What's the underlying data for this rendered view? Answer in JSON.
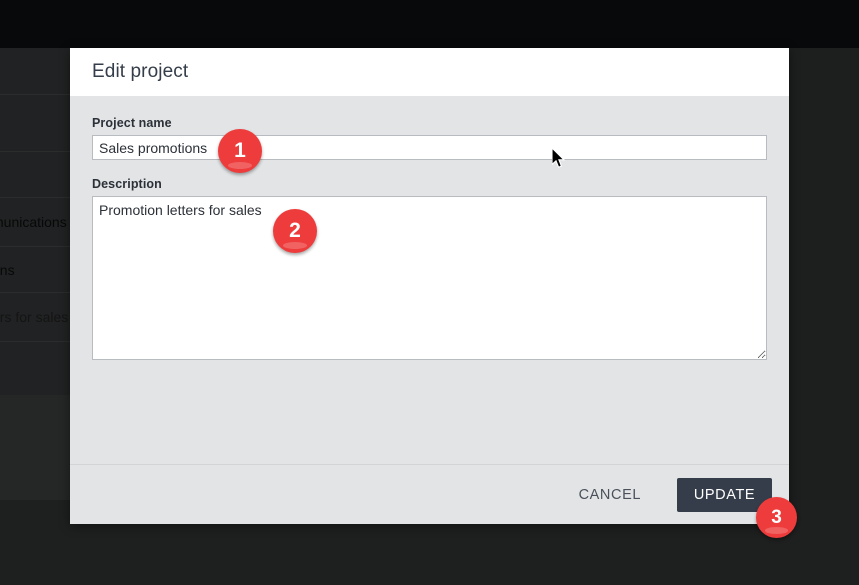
{
  "modal": {
    "title": "Edit project",
    "fields": [
      {
        "label": "Project name",
        "value": "Sales promotions",
        "placeholder": ""
      },
      {
        "label": "Description",
        "value": "Promotion letters for sales",
        "placeholder": ""
      }
    ],
    "footer": {
      "cancel_label": "CANCEL",
      "update_label": "UPDATE"
    }
  },
  "annotations": [
    {
      "number": "1"
    },
    {
      "number": "2"
    },
    {
      "number": "3"
    }
  ],
  "background": {
    "rows": [
      {
        "label": ""
      },
      {
        "label": ""
      },
      {
        "label": ""
      },
      {
        "label": "munications"
      },
      {
        "label": "ons"
      },
      {
        "label": "ers for sales"
      },
      {
        "label": ""
      }
    ]
  },
  "colors": {
    "badge_red": "#ee3b3b",
    "primary_button": "#343d49",
    "modal_body": "#e2e4e6",
    "modal_header": "#ffffff",
    "topbar": "#08090a"
  },
  "cursor": {
    "icon": "arrow-pointer"
  }
}
